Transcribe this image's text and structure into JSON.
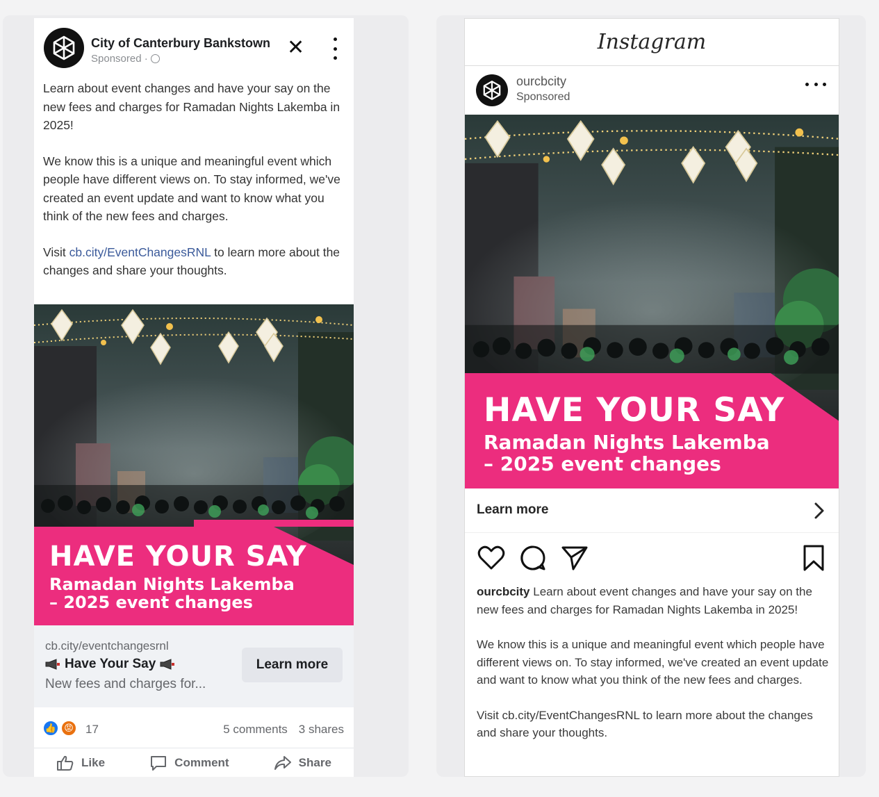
{
  "facebook": {
    "page_name": "City of Canterbury Bankstown",
    "sponsored": "Sponsored ·",
    "post_paragraphs": [
      "Learn about event changes and have your say on the new fees and charges for Ramadan Nights Lakemba in 2025!",
      "We know this is a unique and meaningful event which people have different views on. To stay informed, we've created an event update and want to know what you think of the new fees and charges."
    ],
    "visit_prefix": "Visit ",
    "visit_link": "cb.city/EventChangesRNL",
    "visit_suffix": " to learn more about the changes and share your thoughts.",
    "banner": {
      "headline": "HAVE YOUR SAY",
      "sub_line1": "Ramadan Nights Lakemba",
      "sub_line2": "– 2025 event changes"
    },
    "preview": {
      "domain": "cb.city/eventchangesrnl",
      "title": "Have Your Say",
      "description": "New fees and charges for...",
      "button": "Learn more"
    },
    "reactions": {
      "count": "17",
      "comments": "5 comments",
      "shares": "3 shares"
    },
    "actions": {
      "like": "Like",
      "comment": "Comment",
      "share": "Share"
    }
  },
  "instagram": {
    "logo": "Instagram",
    "username": "ourcbcity",
    "sponsored": "Sponsored",
    "banner": {
      "headline": "HAVE YOUR SAY",
      "sub_line1": "Ramadan Nights Lakemba",
      "sub_line2": "– 2025 event changes"
    },
    "learn_more": "Learn more",
    "caption_user": "ourcbcity",
    "caption_first": " Learn about event changes and have your say on the new fees and charges for Ramadan Nights Lakemba in 2025!",
    "caption_second": "We know this is a unique and meaningful event which people have different views on. To stay informed, we've created an event update and want to know what you think of the new fees and charges.",
    "caption_third": "Visit cb.city/EventChangesRNL to learn more about the changes and share your thoughts."
  },
  "colors": {
    "brand_pink": "#ec2d7e",
    "fb_blue": "#1877f2",
    "link_blue": "#3b5a9a"
  }
}
